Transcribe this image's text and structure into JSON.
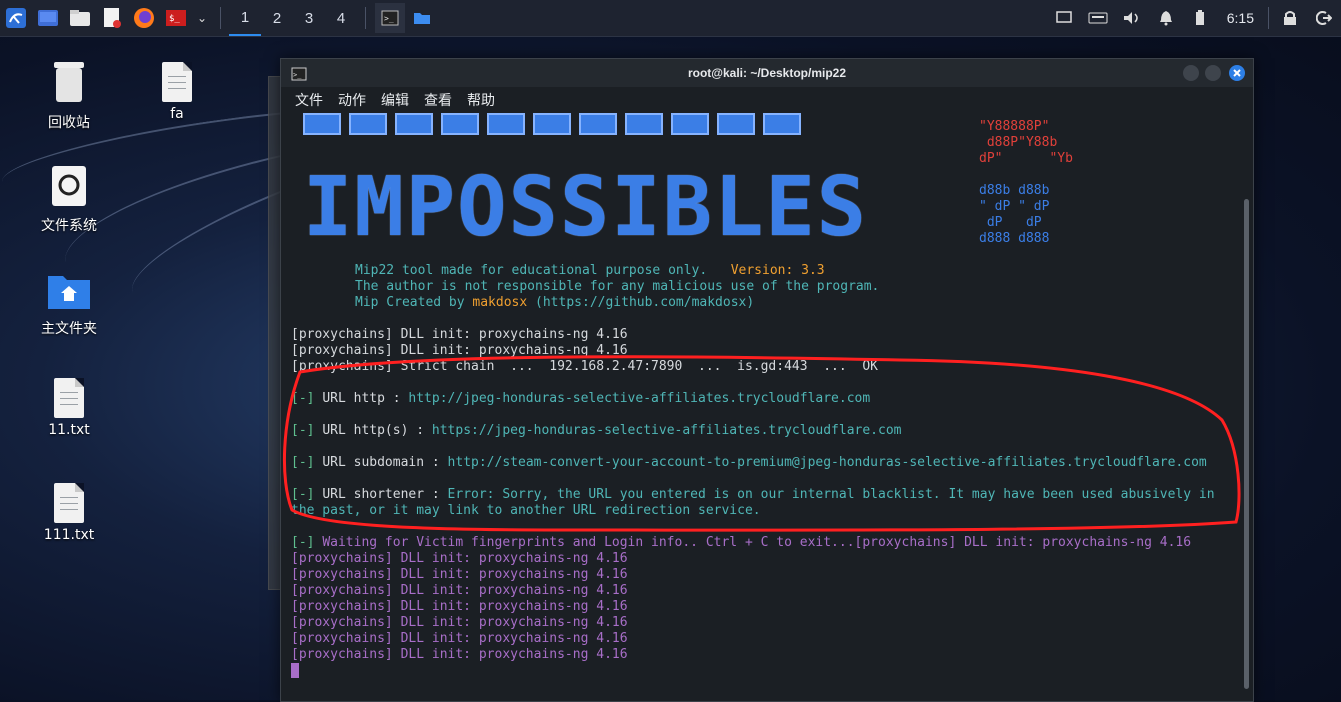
{
  "taskbar": {
    "apps": [
      "kali-menu-icon",
      "workspace-icon",
      "file-manager-icon",
      "text-editor-icon",
      "firefox-icon",
      "terminal-red-icon"
    ],
    "workspaces": [
      "1",
      "2",
      "3",
      "4"
    ],
    "active_workspace": "1",
    "clock": "6:15"
  },
  "desktop": {
    "icons": [
      {
        "label": "回收站",
        "icon": "trash-icon"
      },
      {
        "label": "fa",
        "icon": "document-icon"
      },
      {
        "label": "文件系统",
        "icon": "drive-icon"
      },
      {
        "label": "主文件夹",
        "icon": "home-folder-icon"
      },
      {
        "label": "11.txt",
        "icon": "text-file-icon"
      },
      {
        "label": "111.txt",
        "icon": "text-file-icon"
      }
    ]
  },
  "terminal": {
    "title": "root@kali: ~/Desktop/mip22",
    "menu": [
      "文件",
      "动作",
      "编辑",
      "查看",
      "帮助"
    ],
    "banner_text": "IMPOSSIBLES",
    "ascii_red": [
      "\"Y88888P\"",
      " d88P\"Y88b",
      "dP\"      \"Yb"
    ],
    "ascii_blue": [
      "d88b d88b",
      "\" dP \" dP",
      " dP   dP",
      "d888 d888"
    ],
    "info": {
      "line1": "Mip22 tool made for educational purpose only.",
      "version": "Version: 3.3",
      "line2": "The author is not responsible for any malicious use of the program.",
      "line3_prefix": "Mip Created by ",
      "author": "makdosx",
      "line3_suffix": " (https://github.com/makdosx)"
    },
    "proxy_lines": [
      "[proxychains] DLL init: proxychains-ng 4.16",
      "[proxychains] DLL init: proxychains-ng 4.16",
      "[proxychains] Strict chain  ...  192.168.2.47:7890  ...  is.gd:443  ...  OK"
    ],
    "urls": [
      {
        "label": "URL http : ",
        "value": "http://jpeg-honduras-selective-affiliates.trycloudflare.com"
      },
      {
        "label": "URL http(s) : ",
        "value": "https://jpeg-honduras-selective-affiliates.trycloudflare.com"
      },
      {
        "label": "URL subdomain : ",
        "value": "http://steam-convert-your-account-to-premium@jpeg-honduras-selective-affiliates.trycloudflare.com"
      },
      {
        "label": "URL shortener : ",
        "value": "Error: Sorry, the URL you entered is on our internal blacklist. It may have been used abusively in",
        "value2": "the past, or it may link to another URL redirection service."
      }
    ],
    "waiting": "Waiting for Victim fingerprints and Login info.. Ctrl + C to exit...",
    "waiting_tail": "[proxychains] DLL init: proxychains-ng 4.16",
    "purple_lines": [
      "[proxychains] DLL init: proxychains-ng 4.16",
      "[proxychains] DLL init: proxychains-ng 4.16",
      "[proxychains] DLL init: proxychains-ng 4.16",
      "[proxychains] DLL init: proxychains-ng 4.16",
      "[proxychains] DLL init: proxychains-ng 4.16",
      "[proxychains] DLL init: proxychains-ng 4.16",
      "[proxychains] DLL init: proxychains-ng 4.16"
    ],
    "bracket": "[-]",
    "colors": {
      "cyan": "#4fb6b6",
      "green_bracket": "#5fbf8f",
      "orange": "#f0a030",
      "red": "#e0403a",
      "purple": "#a86ec8",
      "blue": "#3b7ee6"
    }
  }
}
